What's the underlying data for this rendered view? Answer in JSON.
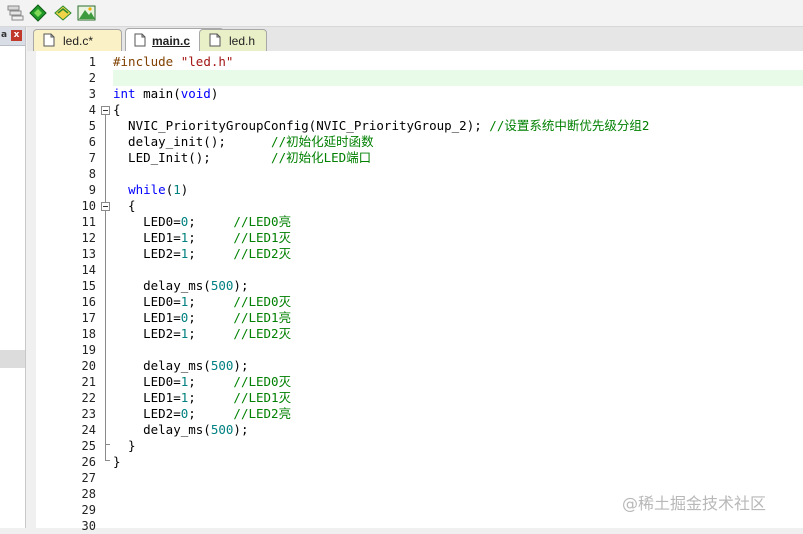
{
  "toolbar": {
    "buttons": [
      {
        "name": "windows-icon"
      },
      {
        "name": "diamond-green-icon"
      },
      {
        "name": "diamond-yellow-icon"
      },
      {
        "name": "mountain-icon"
      }
    ]
  },
  "left_panel": {
    "pin_label": "a",
    "close_label": "x"
  },
  "tabs": [
    {
      "label": "led.c*",
      "active": false
    },
    {
      "label": "main.c",
      "active": true
    },
    {
      "label": "led.h",
      "active": false
    }
  ],
  "editor": {
    "lines": [
      {
        "n": "1",
        "html": "<span class=\"pp\">#include</span> <span class=\"str\">\"led.h\"</span>"
      },
      {
        "n": "2",
        "html": ""
      },
      {
        "n": "3",
        "html": "<span class=\"kw\">int</span> main(<span class=\"kw\">void</span>)"
      },
      {
        "n": "4",
        "html": "{"
      },
      {
        "n": "5",
        "html": "  NVIC_PriorityGroupConfig(NVIC_PriorityGroup_2); <span class=\"cm\">//设置系统中断优先级分组2</span>"
      },
      {
        "n": "6",
        "html": "  delay_init();      <span class=\"cm\">//初始化延时函数</span>"
      },
      {
        "n": "7",
        "html": "  LED_Init();        <span class=\"cm\">//初始化LED端口</span>"
      },
      {
        "n": "8",
        "html": ""
      },
      {
        "n": "9",
        "html": "  <span class=\"kw\">while</span>(<span class=\"num\">1</span>)"
      },
      {
        "n": "10",
        "html": "  {"
      },
      {
        "n": "11",
        "html": "    LED0=<span class=\"num\">0</span>;     <span class=\"cm\">//LED0亮</span>"
      },
      {
        "n": "12",
        "html": "    LED1=<span class=\"num\">1</span>;     <span class=\"cm\">//LED1灭</span>"
      },
      {
        "n": "13",
        "html": "    LED2=<span class=\"num\">1</span>;     <span class=\"cm\">//LED2灭</span>"
      },
      {
        "n": "14",
        "html": ""
      },
      {
        "n": "15",
        "html": "    delay_ms(<span class=\"num\">500</span>);"
      },
      {
        "n": "16",
        "html": "    LED0=<span class=\"num\">1</span>;     <span class=\"cm\">//LED0灭</span>"
      },
      {
        "n": "17",
        "html": "    LED1=<span class=\"num\">0</span>;     <span class=\"cm\">//LED1亮</span>"
      },
      {
        "n": "18",
        "html": "    LED2=<span class=\"num\">1</span>;     <span class=\"cm\">//LED2灭</span>"
      },
      {
        "n": "19",
        "html": ""
      },
      {
        "n": "20",
        "html": "    delay_ms(<span class=\"num\">500</span>);"
      },
      {
        "n": "21",
        "html": "    LED0=<span class=\"num\">1</span>;     <span class=\"cm\">//LED0灭</span>"
      },
      {
        "n": "22",
        "html": "    LED1=<span class=\"num\">1</span>;     <span class=\"cm\">//LED1灭</span>"
      },
      {
        "n": "23",
        "html": "    LED2=<span class=\"num\">0</span>;     <span class=\"cm\">//LED2亮</span>"
      },
      {
        "n": "24",
        "html": "    delay_ms(<span class=\"num\">500</span>);"
      },
      {
        "n": "25",
        "html": "  }"
      },
      {
        "n": "26",
        "html": "}"
      },
      {
        "n": "27",
        "html": ""
      },
      {
        "n": "28",
        "html": ""
      },
      {
        "n": "29",
        "html": ""
      },
      {
        "n": "30",
        "html": ""
      }
    ]
  },
  "watermark": "@稀土掘金技术社区",
  "colors": {
    "keyword": "#0000ff",
    "comment": "#008000",
    "number": "#008080",
    "string": "#a31515",
    "preprocessor": "#804000",
    "current_line": "#e8fae8"
  }
}
